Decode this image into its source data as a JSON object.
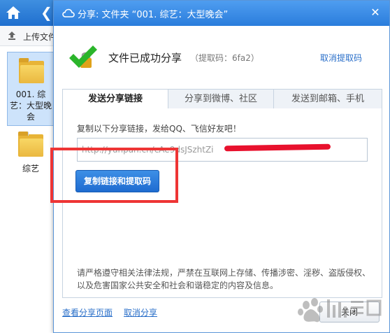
{
  "background": {
    "upload_label": "上传文件",
    "selected_file_name": "001. 综艺：大型晚会",
    "folder2_name": "综艺"
  },
  "dialog": {
    "title": "分享: 文件夹 “001. 综艺：大型晚会”",
    "success_message": "文件已成功分享",
    "extract_code": "（提取码：6fa2）",
    "cancel_extract_code": "取消提取码",
    "tabs": [
      {
        "label": "发送分享链接",
        "active": true
      },
      {
        "label": "分享到微博、社区",
        "active": false
      },
      {
        "label": "发送到邮箱、手机",
        "active": false
      }
    ],
    "instruction": "复制以下分享链接，发给QQ、飞信好友吧！",
    "share_link": "http://yunpan.cn/cAe9dsJSzhtZi",
    "copy_button": "复制链接和提取码",
    "notice": "请严格遵守相关法律法规，严禁在互联网上存储、传播涉密、淫秽、盗版侵权、以及危害国家公共安全和社会和谐稳定的内容及信息。",
    "view_share_page": "查看分享页面",
    "cancel_share": "取消分享",
    "close_button": "关闭"
  },
  "colors": {
    "accent": "#2a7ddc",
    "link": "#2a6fc9",
    "highlight": "#ee3535",
    "redaction": "#e8112d",
    "success": "#2bb52b"
  },
  "icons": {
    "home": "home-icon",
    "back": "back-icon",
    "upload": "upload-icon",
    "folder": "folder-icon",
    "cloud": "cloud-icon",
    "close": "close-icon",
    "success": "check-lock-icon"
  }
}
